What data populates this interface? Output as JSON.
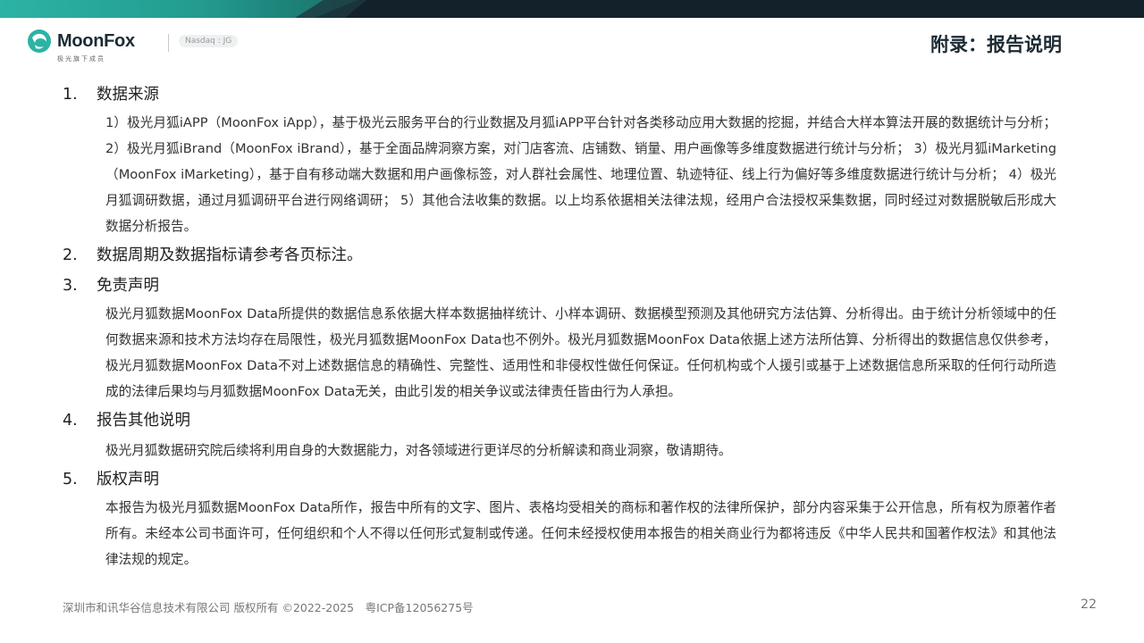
{
  "brand": {
    "name": "MoonFox",
    "subtitle": "极光旗下成员",
    "ticker": "Nasdaq : JG",
    "colors": {
      "teal": "#2cb3a4",
      "dark": "#13212b"
    },
    "icon": "moonfox-logo-icon"
  },
  "page_title": "附录：报告说明",
  "sections": [
    {
      "number": "1.",
      "title": "数据来源",
      "body": "1）极光月狐iAPP（MoonFox iApp），基于极光云服务平台的行业数据及月狐iAPP平台针对各类移动应用大数据的挖掘，并结合大样本算法开展的数据统计与分析； 2）极光月狐iBrand（MoonFox iBrand），基于全面品牌洞察方案，对门店客流、店铺数、销量、用户画像等多维度数据进行统计与分析； 3）极光月狐iMarketing（MoonFox iMarketing），基于自有移动端大数据和用户画像标签，对人群社会属性、地理位置、轨迹特征、线上行为偏好等多维度数据进行统计与分析； 4）极光月狐调研数据，通过月狐调研平台进行网络调研； 5）其他合法收集的数据。以上均系依据相关法律法规，经用户合法授权采集数据，同时经过对数据脱敏后形成大数据分析报告。"
    },
    {
      "number": "2.",
      "title": "数据周期及数据指标请参考各页标注。",
      "body": ""
    },
    {
      "number": "3.",
      "title": "免责声明",
      "body": "极光月狐数据MoonFox Data所提供的数据信息系依据大样本数据抽样统计、小样本调研、数据模型预测及其他研究方法估算、分析得出。由于统计分析领域中的任何数据来源和技术方法均存在局限性，极光月狐数据MoonFox Data也不例外。极光月狐数据MoonFox Data依据上述方法所估算、分析得出的数据信息仅供参考，极光月狐数据MoonFox Data不对上述数据信息的精确性、完整性、适用性和非侵权性做任何保证。任何机构或个人援引或基于上述数据信息所采取的任何行动所造成的法律后果均与月狐数据MoonFox Data无关，由此引发的相关争议或法律责任皆由行为人承担。"
    },
    {
      "number": "4.",
      "title": "报告其他说明",
      "body": "极光月狐数据研究院后续将利用自身的大数据能力，对各领域进行更详尽的分析解读和商业洞察，敬请期待。"
    },
    {
      "number": "5.",
      "title": "版权声明",
      "body": "本报告为极光月狐数据MoonFox Data所作，报告中所有的文字、图片、表格均受相关的商标和著作权的法律所保护，部分内容采集于公开信息，所有权为原著作者所有。未经本公司书面许可，任何组织和个人不得以任何形式复制或传递。任何未经授权使用本报告的相关商业行为都将违反《中华人民共和国著作权法》和其他法律法规的规定。"
    }
  ],
  "footer": {
    "copyright": "深圳市和讯华谷信息技术有限公司 版权所有 ©2022-2025　粤ICP备12056275号",
    "page_number": "22"
  }
}
